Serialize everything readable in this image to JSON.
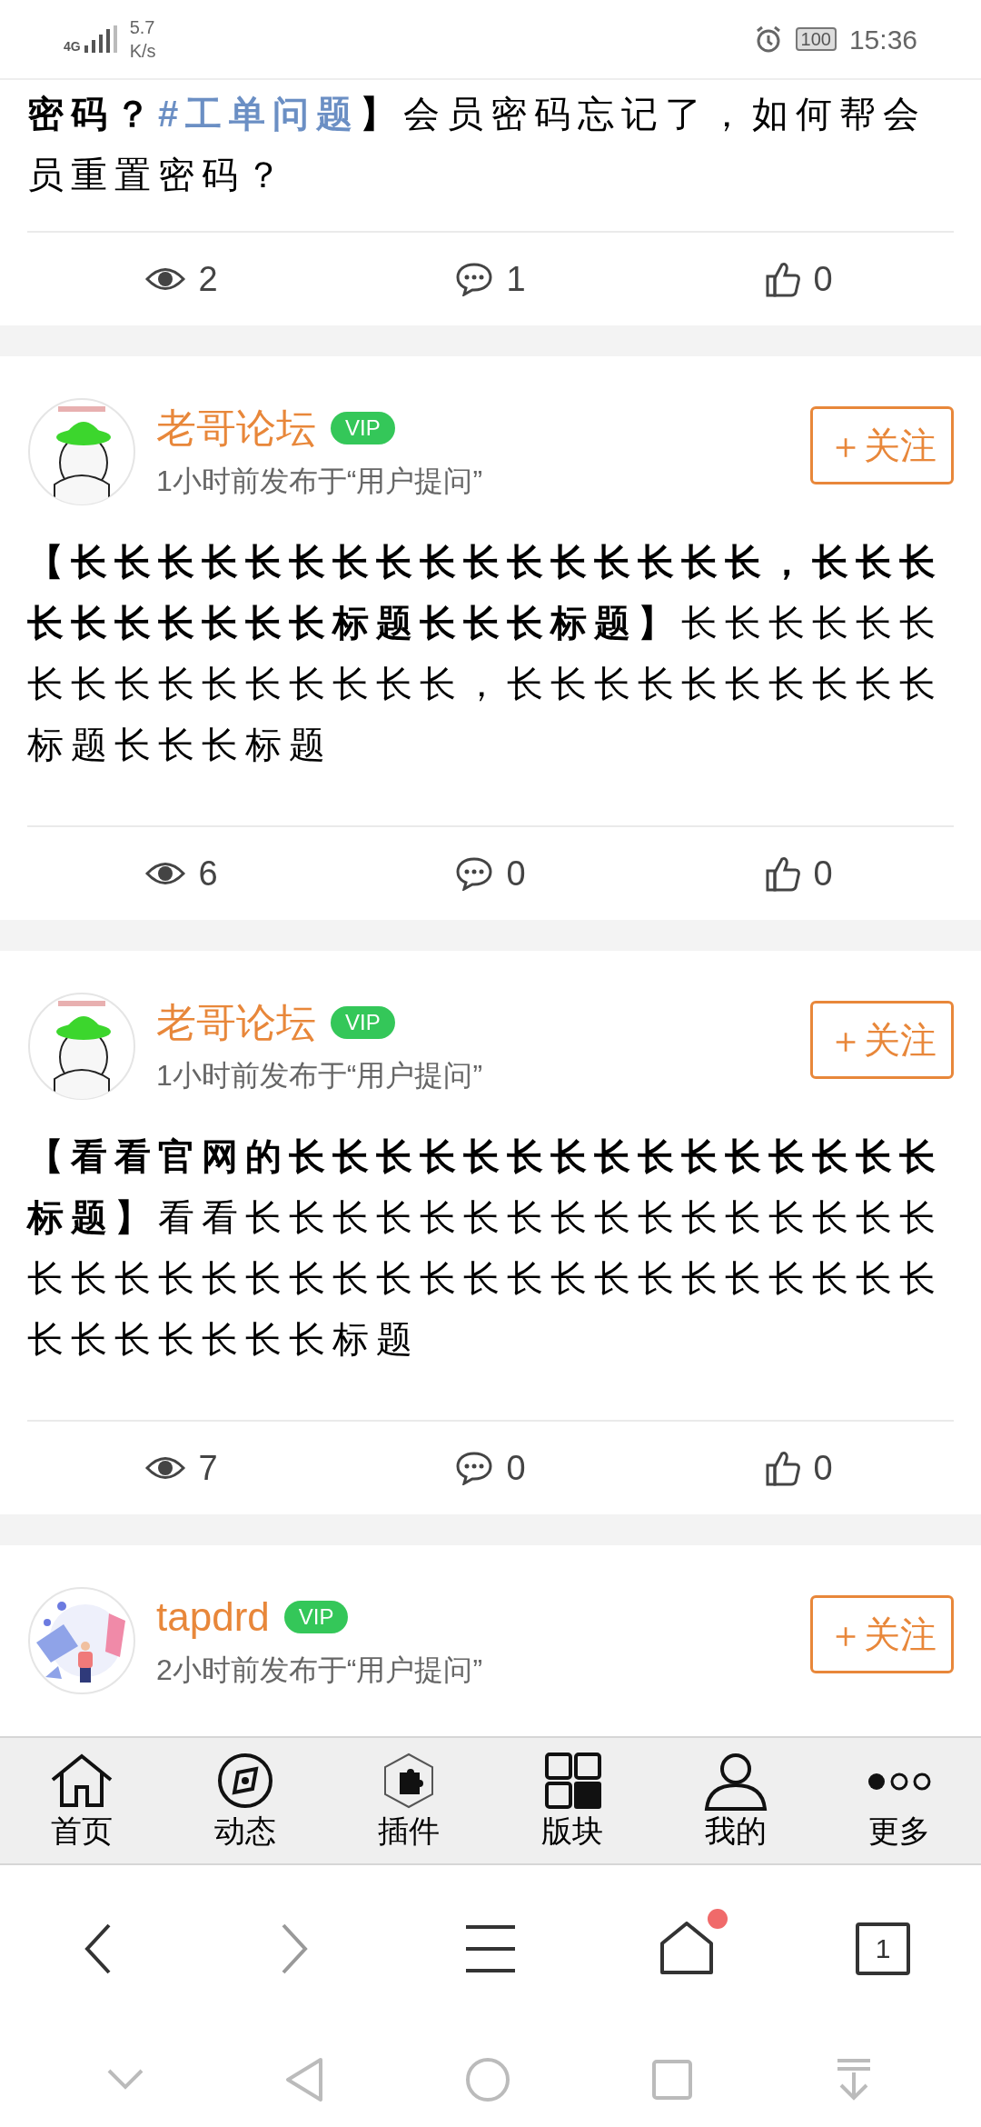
{
  "status_bar": {
    "network": "4G",
    "speed": [
      "5.7",
      "K/s"
    ],
    "battery": "100",
    "time": "15:36"
  },
  "posts": [
    {
      "title": [
        {
          "kind": "bold",
          "text": "密码？"
        },
        {
          "kind": "tag",
          "text": "#工单问题"
        },
        {
          "kind": "bold",
          "text": "】"
        },
        {
          "kind": "plain",
          "text": "会员密码忘记了，如何帮会员重置密码？"
        }
      ],
      "stats": {
        "views": "2",
        "comments": "1",
        "likes": "0"
      }
    },
    {
      "author": {
        "name": "老哥论坛",
        "badge": "VIP",
        "meta": "1小时前发布于“用户提问”",
        "follow": "＋关注"
      },
      "title": [
        {
          "kind": "bold",
          "text": "【长长长长长长长长长长长长长长长长，长长长长长长长长长长标题长长长标题】"
        },
        {
          "kind": "plain",
          "text": "长长长长长长长长长长长长长长长长，长长长长长长长长长长标题长长长标题"
        }
      ],
      "stats": {
        "views": "6",
        "comments": "0",
        "likes": "0"
      }
    },
    {
      "author": {
        "name": "老哥论坛",
        "badge": "VIP",
        "meta": "1小时前发布于“用户提问”",
        "follow": "＋关注"
      },
      "title": [
        {
          "kind": "bold",
          "text": "【看看官网的长长长长长长长长长长长长长长长标题】"
        },
        {
          "kind": "plain",
          "text": "看看长长长长长长长长长长长长长长长长长长长长长长长长长长长长长长长长长长长长长长长长长长长长标题"
        }
      ],
      "stats": {
        "views": "7",
        "comments": "0",
        "likes": "0"
      }
    },
    {
      "author": {
        "name": "tapdrd",
        "badge": "VIP",
        "meta": "2小时前发布于“用户提问”",
        "follow": "＋关注"
      }
    }
  ],
  "tab_bar": [
    {
      "label": "首页"
    },
    {
      "label": "动态"
    },
    {
      "label": "插件"
    },
    {
      "label": "版块"
    },
    {
      "label": "我的"
    },
    {
      "label": "更多"
    }
  ],
  "browser_bar": {
    "tabs_count": "1",
    "home_dot": true
  }
}
